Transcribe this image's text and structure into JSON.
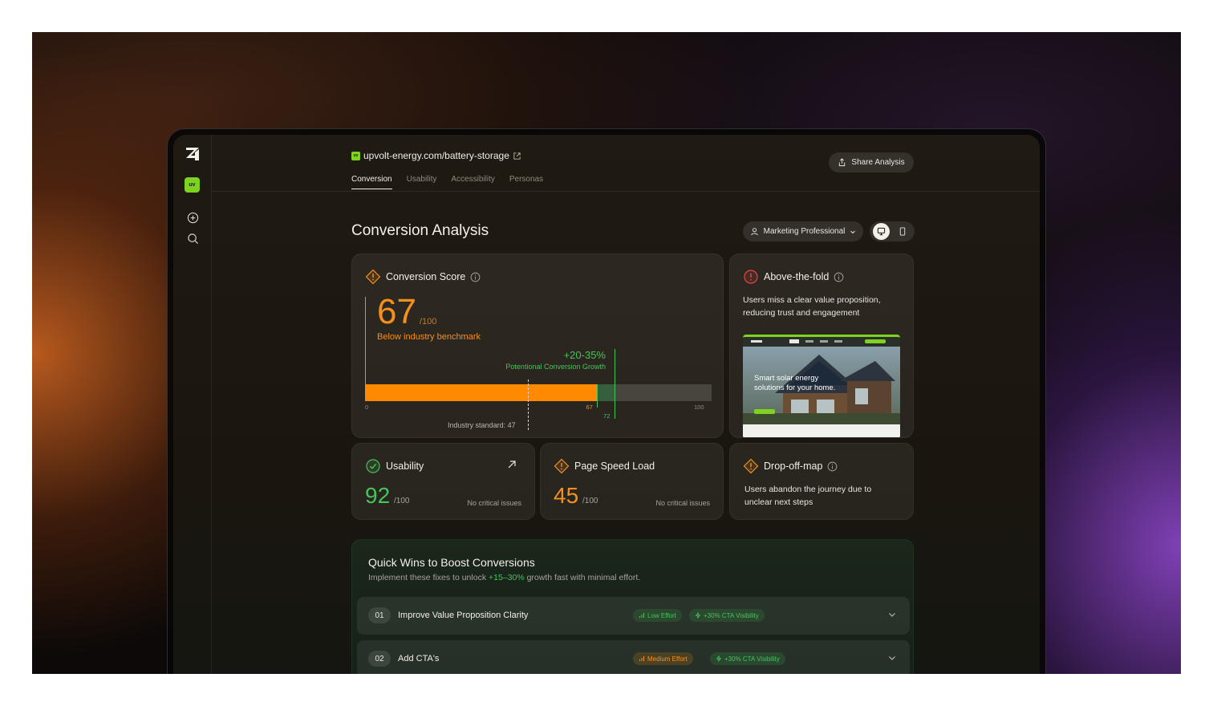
{
  "app": {
    "url": "upvolt-energy.com/battery-storage",
    "site_badge": "uv",
    "share_label": "Share Analysis",
    "tabs": [
      {
        "label": "Conversion",
        "active": true
      },
      {
        "label": "Usability",
        "active": false
      },
      {
        "label": "Accessibility",
        "active": false
      },
      {
        "label": "Personas",
        "active": false
      }
    ]
  },
  "sidebar": {
    "badge": "uv",
    "icons": [
      "logo-icon",
      "add-icon",
      "search-icon"
    ]
  },
  "page": {
    "title": "Conversion Analysis",
    "persona": "Marketing Professional",
    "device_modes": [
      "desktop-icon",
      "mobile-icon"
    ],
    "active_device": "desktop"
  },
  "conversion_score": {
    "title": "Conversion Score",
    "score": "67",
    "max": "/100",
    "note": "Below industry benchmark",
    "growth": "+20-35%",
    "growth_label": "Potentional Conversion Growth",
    "bar": {
      "current": 67,
      "potential": 72,
      "industry": 47,
      "scale_min": 0,
      "scale_max": 100
    },
    "tick_labels": {
      "min": "0",
      "current": "67",
      "potential": "72",
      "max": "100"
    },
    "industry_label": "Industry standard: 47"
  },
  "above_fold": {
    "title": "Above-the-fold",
    "text": "Users miss a clear value proposition, reducing trust and engagement",
    "thumbnail_text": "Smart solar energy solutions for your home."
  },
  "usability": {
    "title": "Usability",
    "score": "92",
    "max": "/100",
    "note": "No critical issues"
  },
  "page_speed": {
    "title": "Page Speed Load",
    "score": "45",
    "max": "/100",
    "note": "No critical issues"
  },
  "dropoff": {
    "title": "Drop-off-map",
    "text": "Users abandon the journey due to unclear next steps"
  },
  "quick_wins": {
    "title": "Quick Wins to Boost Conversions",
    "subtitle_pre": "Implement these fixes to unlock ",
    "subtitle_highlight": "+15–30%",
    "subtitle_post": " growth fast with minimal effort.",
    "items": [
      {
        "num": "01",
        "label": "Improve Value Proposition Clarity",
        "effort": "Low Effort",
        "impact": "+30% CTA Visibility"
      },
      {
        "num": "02",
        "label": "Add CTA's",
        "effort": "Medium Effort",
        "impact": "+30% CTA Visibility"
      }
    ]
  },
  "colors": {
    "accent_orange": "#f5901c",
    "accent_green": "#46c35a",
    "brand_lime": "#7ed321",
    "alert_red": "#e5484d"
  }
}
